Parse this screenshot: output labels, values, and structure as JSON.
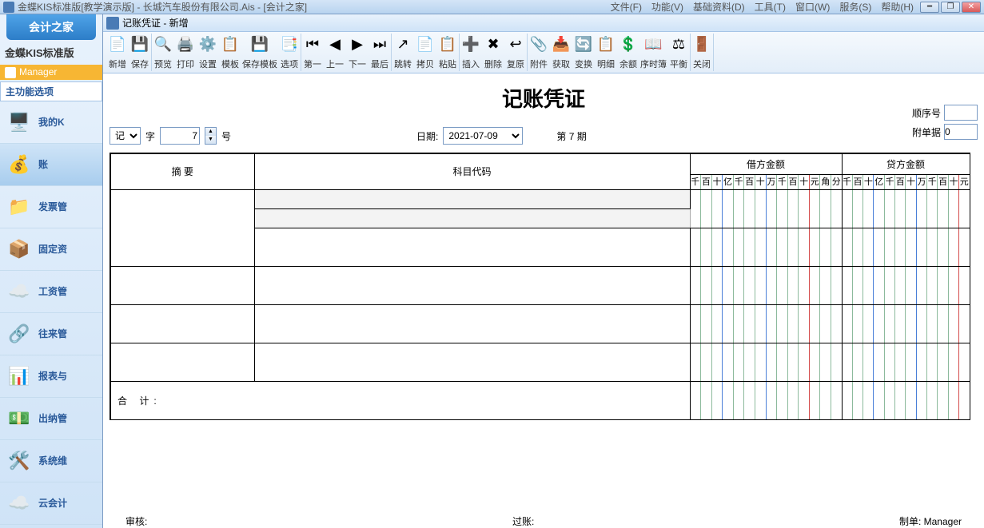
{
  "titlebar": {
    "product": "金蝶KIS标准版",
    "edition": "[教学演示版]",
    "dash": " - ",
    "company": "长城汽车股份有限公司.Ais",
    "module": " - [会计之家]"
  },
  "menu": {
    "file": "文件(F)",
    "func": "功能(V)",
    "base": "基础资料(D)",
    "tool": "工具(T)",
    "win": "窗口(W)",
    "serv": "服务(S)",
    "help": "帮助(H)"
  },
  "sidebar": {
    "home_tab": "会计之家",
    "product_line": "金蝶KIS标准版",
    "user": "Manager",
    "main_opts": "主功能选项",
    "items": [
      {
        "icon": "🖥️",
        "label": "我的K"
      },
      {
        "icon": "💰",
        "label": "账"
      },
      {
        "icon": "📁",
        "label": "发票管"
      },
      {
        "icon": "📦",
        "label": "固定资"
      },
      {
        "icon": "☁️",
        "label": "工资管"
      },
      {
        "icon": "🔗",
        "label": "往来管"
      },
      {
        "icon": "📊",
        "label": "报表与"
      },
      {
        "icon": "💵",
        "label": "出纳管"
      },
      {
        "icon": "🛠️",
        "label": "系统维"
      },
      {
        "icon": "☁️",
        "label": "云会计"
      }
    ]
  },
  "subwindow_title": "记账凭证 - 新增",
  "toolbar": [
    {
      "icon": "📄",
      "label": "新增"
    },
    {
      "icon": "💾",
      "label": "保存"
    },
    {
      "icon": "🔍",
      "label": "预览"
    },
    {
      "icon": "🖨️",
      "label": "打印"
    },
    {
      "icon": "⚙️",
      "label": "设置"
    },
    {
      "icon": "📋",
      "label": "模板"
    },
    {
      "icon": "💾",
      "label": "保存模板"
    },
    {
      "icon": "📑",
      "label": "选项"
    },
    {
      "icon": "⏮",
      "label": "第一"
    },
    {
      "icon": "◀",
      "label": "上一"
    },
    {
      "icon": "▶",
      "label": "下一"
    },
    {
      "icon": "⏭",
      "label": "最后"
    },
    {
      "icon": "↗",
      "label": "跳转"
    },
    {
      "icon": "📄",
      "label": "拷贝"
    },
    {
      "icon": "📋",
      "label": "粘贴"
    },
    {
      "icon": "➕",
      "label": "插入"
    },
    {
      "icon": "✖",
      "label": "删除"
    },
    {
      "icon": "↩",
      "label": "复原"
    },
    {
      "icon": "📎",
      "label": "附件"
    },
    {
      "icon": "📥",
      "label": "获取"
    },
    {
      "icon": "🔄",
      "label": "变换"
    },
    {
      "icon": "📋",
      "label": "明细"
    },
    {
      "icon": "💲",
      "label": "余额"
    },
    {
      "icon": "📖",
      "label": "序时簿"
    },
    {
      "icon": "⚖",
      "label": "平衡"
    },
    {
      "icon": "🚪",
      "label": "关闭"
    }
  ],
  "voucher": {
    "title": "记账凭证",
    "type_select": "记",
    "char_label": "字",
    "number": "7",
    "num_label": "号",
    "date_label": "日期:",
    "date": "2021-07-09",
    "period_label_pre": "第 ",
    "period_num": "7",
    "period_label_post": " 期",
    "seq_label": "顺序号",
    "attach_label": "附单据",
    "attach_value": "0",
    "col_summary": "摘    要",
    "col_subject": "科目代码",
    "col_debit": "借方金额",
    "col_credit": "贷方金额",
    "digit_header": [
      "千",
      "百",
      "十",
      "亿",
      "千",
      "百",
      "十",
      "万",
      "千",
      "百",
      "十",
      "元",
      "角",
      "分"
    ],
    "digit_header_credit": [
      "千",
      "百",
      "十",
      "亿",
      "千",
      "百",
      "十",
      "万",
      "千",
      "百",
      "十",
      "元"
    ],
    "total_label": "合  计:"
  },
  "footer": {
    "audit": "审核:",
    "post": "过账:",
    "maker_label": "制单:",
    "maker_value": "Manager"
  }
}
